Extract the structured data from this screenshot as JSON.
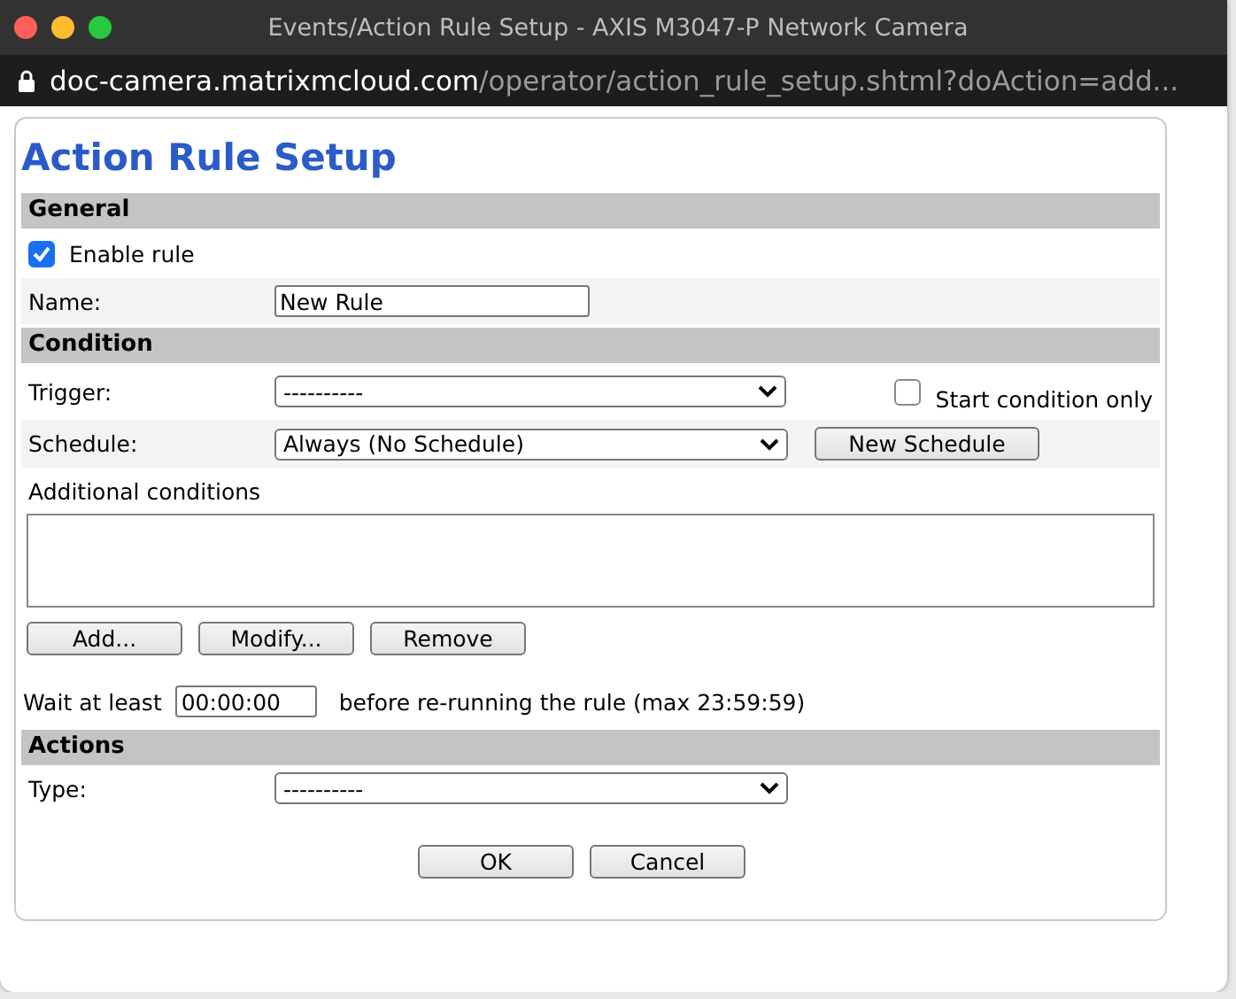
{
  "window": {
    "title": "Events/Action Rule Setup - AXIS M3047-P Network Camera",
    "url_host": "doc-camera.matrixmcloud.com",
    "url_path": "/operator/action_rule_setup.shtml?doAction=add..."
  },
  "heading": "Action Rule Setup",
  "general": {
    "header": "General",
    "enable": {
      "label": "Enable rule",
      "checked": true
    },
    "name": {
      "label": "Name:",
      "value": "New Rule"
    }
  },
  "condition": {
    "header": "Condition",
    "trigger": {
      "label": "Trigger:",
      "value": "----------"
    },
    "start_only": {
      "label": "Start condition only",
      "checked": false
    },
    "schedule": {
      "label": "Schedule:",
      "value": "Always (No Schedule)",
      "button": "New Schedule"
    },
    "additional_label": "Additional conditions",
    "buttons": [
      "Add...",
      "Modify...",
      "Remove"
    ],
    "wait": {
      "label": "Wait at least",
      "value": "00:00:00",
      "suffix": "before re-running the rule (max 23:59:59)"
    }
  },
  "actions": {
    "header": "Actions",
    "type": {
      "label": "Type:",
      "value": "----------"
    }
  },
  "buttons": [
    "OK",
    "Cancel"
  ]
}
